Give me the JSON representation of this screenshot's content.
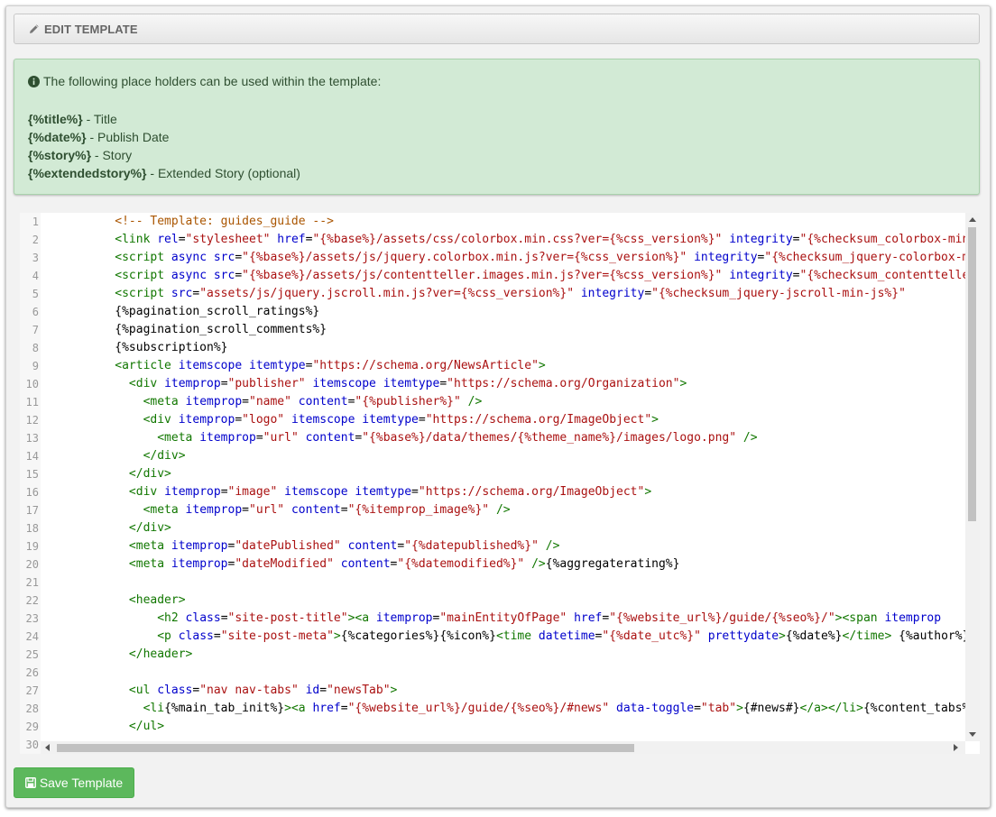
{
  "panel": {
    "heading": "EDIT TEMPLATE",
    "heading_icon": "pencil-icon"
  },
  "info": {
    "icon": "info-circle-icon",
    "intro": "The following place holders can be used within the template:",
    "placeholders": [
      {
        "token": "{%title%}",
        "desc": " - Title"
      },
      {
        "token": "{%date%}",
        "desc": " - Publish Date"
      },
      {
        "token": "{%story%}",
        "desc": " - Story"
      },
      {
        "token": "{%extendedstory%}",
        "desc": " - Extended Story (optional)"
      }
    ]
  },
  "editor": {
    "line_numbers": [
      "1",
      "2",
      "3",
      "4",
      "5",
      "6",
      "7",
      "8",
      "9",
      "10",
      "11",
      "12",
      "13",
      "14",
      "15",
      "16",
      "17",
      "18",
      "19",
      "20",
      "21",
      "22",
      "23",
      "24",
      "25",
      "26",
      "27",
      "28",
      "29",
      "30"
    ],
    "lines": [
      [
        [
          "cm",
          "          <!-- Template: guides_guide -->"
        ]
      ],
      [
        [
          "tg",
          "          <link "
        ],
        [
          "at",
          "rel"
        ],
        [
          "tx",
          "="
        ],
        [
          "st",
          "\"stylesheet\""
        ],
        [
          "tx",
          " "
        ],
        [
          "at",
          "href"
        ],
        [
          "tx",
          "="
        ],
        [
          "st",
          "\"{%base%}/assets/css/colorbox.min.css?ver={%css_version%}\""
        ],
        [
          "tx",
          " "
        ],
        [
          "at",
          "integrity"
        ],
        [
          "tx",
          "="
        ],
        [
          "st",
          "\"{%checksum_colorbox-min-css%}\""
        ]
      ],
      [
        [
          "tg",
          "          <script "
        ],
        [
          "at",
          "async"
        ],
        [
          "tx",
          " "
        ],
        [
          "at",
          "src"
        ],
        [
          "tx",
          "="
        ],
        [
          "st",
          "\"{%base%}/assets/js/jquery.colorbox.min.js?ver={%css_version%}\""
        ],
        [
          "tx",
          " "
        ],
        [
          "at",
          "integrity"
        ],
        [
          "tx",
          "="
        ],
        [
          "st",
          "\"{%checksum_jquery-colorbox-min-js%}\""
        ]
      ],
      [
        [
          "tg",
          "          <script "
        ],
        [
          "at",
          "async"
        ],
        [
          "tx",
          " "
        ],
        [
          "at",
          "src"
        ],
        [
          "tx",
          "="
        ],
        [
          "st",
          "\"{%base%}/assets/js/contentteller.images.min.js?ver={%css_version%}\""
        ],
        [
          "tx",
          " "
        ],
        [
          "at",
          "integrity"
        ],
        [
          "tx",
          "="
        ],
        [
          "st",
          "\"{%checksum_contentteller-images-min-js%}\""
        ]
      ],
      [
        [
          "tg",
          "          <script "
        ],
        [
          "at",
          "src"
        ],
        [
          "tx",
          "="
        ],
        [
          "st",
          "\"assets/js/jquery.jscroll.min.js?ver={%css_version%}\""
        ],
        [
          "tx",
          " "
        ],
        [
          "at",
          "integrity"
        ],
        [
          "tx",
          "="
        ],
        [
          "st",
          "\"{%checksum_jquery-jscroll-min-js%}\""
        ]
      ],
      [
        [
          "tx",
          "          {%pagination_scroll_ratings%}"
        ]
      ],
      [
        [
          "tx",
          "          {%pagination_scroll_comments%}"
        ]
      ],
      [
        [
          "tx",
          "          {%subscription%}"
        ]
      ],
      [
        [
          "tg",
          "          <article "
        ],
        [
          "at",
          "itemscope"
        ],
        [
          "tx",
          " "
        ],
        [
          "at",
          "itemtype"
        ],
        [
          "tx",
          "="
        ],
        [
          "st",
          "\"https://schema.org/NewsArticle\""
        ],
        [
          "tg",
          ">"
        ]
      ],
      [
        [
          "tg",
          "            <div "
        ],
        [
          "at",
          "itemprop"
        ],
        [
          "tx",
          "="
        ],
        [
          "st",
          "\"publisher\""
        ],
        [
          "tx",
          " "
        ],
        [
          "at",
          "itemscope"
        ],
        [
          "tx",
          " "
        ],
        [
          "at",
          "itemtype"
        ],
        [
          "tx",
          "="
        ],
        [
          "st",
          "\"https://schema.org/Organization\""
        ],
        [
          "tg",
          ">"
        ]
      ],
      [
        [
          "tg",
          "              <meta "
        ],
        [
          "at",
          "itemprop"
        ],
        [
          "tx",
          "="
        ],
        [
          "st",
          "\"name\""
        ],
        [
          "tx",
          " "
        ],
        [
          "at",
          "content"
        ],
        [
          "tx",
          "="
        ],
        [
          "st",
          "\"{%publisher%}\""
        ],
        [
          "tx",
          " "
        ],
        [
          "tg",
          "/>"
        ]
      ],
      [
        [
          "tg",
          "              <div "
        ],
        [
          "at",
          "itemprop"
        ],
        [
          "tx",
          "="
        ],
        [
          "st",
          "\"logo\""
        ],
        [
          "tx",
          " "
        ],
        [
          "at",
          "itemscope"
        ],
        [
          "tx",
          " "
        ],
        [
          "at",
          "itemtype"
        ],
        [
          "tx",
          "="
        ],
        [
          "st",
          "\"https://schema.org/ImageObject\""
        ],
        [
          "tg",
          ">"
        ]
      ],
      [
        [
          "tg",
          "                <meta "
        ],
        [
          "at",
          "itemprop"
        ],
        [
          "tx",
          "="
        ],
        [
          "st",
          "\"url\""
        ],
        [
          "tx",
          " "
        ],
        [
          "at",
          "content"
        ],
        [
          "tx",
          "="
        ],
        [
          "st",
          "\"{%base%}/data/themes/{%theme_name%}/images/logo.png\""
        ],
        [
          "tx",
          " "
        ],
        [
          "tg",
          "/>"
        ]
      ],
      [
        [
          "tg",
          "              </div>"
        ]
      ],
      [
        [
          "tg",
          "            </div>"
        ]
      ],
      [
        [
          "tg",
          "            <div "
        ],
        [
          "at",
          "itemprop"
        ],
        [
          "tx",
          "="
        ],
        [
          "st",
          "\"image\""
        ],
        [
          "tx",
          " "
        ],
        [
          "at",
          "itemscope"
        ],
        [
          "tx",
          " "
        ],
        [
          "at",
          "itemtype"
        ],
        [
          "tx",
          "="
        ],
        [
          "st",
          "\"https://schema.org/ImageObject\""
        ],
        [
          "tg",
          ">"
        ]
      ],
      [
        [
          "tg",
          "              <meta "
        ],
        [
          "at",
          "itemprop"
        ],
        [
          "tx",
          "="
        ],
        [
          "st",
          "\"url\""
        ],
        [
          "tx",
          " "
        ],
        [
          "at",
          "content"
        ],
        [
          "tx",
          "="
        ],
        [
          "st",
          "\"{%itemprop_image%}\""
        ],
        [
          "tx",
          " "
        ],
        [
          "tg",
          "/>"
        ]
      ],
      [
        [
          "tg",
          "            </div>"
        ]
      ],
      [
        [
          "tg",
          "            <meta "
        ],
        [
          "at",
          "itemprop"
        ],
        [
          "tx",
          "="
        ],
        [
          "st",
          "\"datePublished\""
        ],
        [
          "tx",
          " "
        ],
        [
          "at",
          "content"
        ],
        [
          "tx",
          "="
        ],
        [
          "st",
          "\"{%datepublished%}\""
        ],
        [
          "tx",
          " "
        ],
        [
          "tg",
          "/>"
        ]
      ],
      [
        [
          "tg",
          "            <meta "
        ],
        [
          "at",
          "itemprop"
        ],
        [
          "tx",
          "="
        ],
        [
          "st",
          "\"dateModified\""
        ],
        [
          "tx",
          " "
        ],
        [
          "at",
          "content"
        ],
        [
          "tx",
          "="
        ],
        [
          "st",
          "\"{%datemodified%}\""
        ],
        [
          "tx",
          " "
        ],
        [
          "tg",
          "/>"
        ],
        [
          "tx",
          "{%aggregaterating%}"
        ]
      ],
      [],
      [
        [
          "tg",
          "            <header>"
        ]
      ],
      [
        [
          "tg",
          "                <h2 "
        ],
        [
          "at",
          "class"
        ],
        [
          "tx",
          "="
        ],
        [
          "st",
          "\"site-post-title\""
        ],
        [
          "tg",
          "><a "
        ],
        [
          "at",
          "itemprop"
        ],
        [
          "tx",
          "="
        ],
        [
          "st",
          "\"mainEntityOfPage\""
        ],
        [
          "tx",
          " "
        ],
        [
          "at",
          "href"
        ],
        [
          "tx",
          "="
        ],
        [
          "st",
          "\"{%website_url%}/guide/{%seo%}/\""
        ],
        [
          "tg",
          "><span "
        ],
        [
          "at",
          "itemprop"
        ]
      ],
      [
        [
          "tg",
          "                <p "
        ],
        [
          "at",
          "class"
        ],
        [
          "tx",
          "="
        ],
        [
          "st",
          "\"site-post-meta\""
        ],
        [
          "tg",
          ">"
        ],
        [
          "tx",
          "{%categories%}{%icon%}"
        ],
        [
          "tg",
          "<time "
        ],
        [
          "at",
          "datetime"
        ],
        [
          "tx",
          "="
        ],
        [
          "st",
          "\"{%date_utc%}\""
        ],
        [
          "tx",
          " "
        ],
        [
          "at",
          "prettydate"
        ],
        [
          "tg",
          ">"
        ],
        [
          "tx",
          "{%date%}"
        ],
        [
          "tg",
          "</time>"
        ],
        [
          "tx",
          " {%author%}"
        ]
      ],
      [
        [
          "tg",
          "            </header>"
        ]
      ],
      [],
      [
        [
          "tg",
          "            <ul "
        ],
        [
          "at",
          "class"
        ],
        [
          "tx",
          "="
        ],
        [
          "st",
          "\"nav nav-tabs\""
        ],
        [
          "tx",
          " "
        ],
        [
          "at",
          "id"
        ],
        [
          "tx",
          "="
        ],
        [
          "st",
          "\"newsTab\""
        ],
        [
          "tg",
          ">"
        ]
      ],
      [
        [
          "tg",
          "              <li"
        ],
        [
          "tx",
          "{%main_tab_init%}"
        ],
        [
          "tg",
          "><a "
        ],
        [
          "at",
          "href"
        ],
        [
          "tx",
          "="
        ],
        [
          "st",
          "\"{%website_url%}/guide/{%seo%}/#news\""
        ],
        [
          "tx",
          " "
        ],
        [
          "at",
          "data-toggle"
        ],
        [
          "tx",
          "="
        ],
        [
          "st",
          "\"tab\""
        ],
        [
          "tg",
          ">"
        ],
        [
          "tx",
          "{#news#}"
        ],
        [
          "tg",
          "</a></li>"
        ],
        [
          "tx",
          "{%content_tabs%}"
        ]
      ],
      [
        [
          "tg",
          "            </ul>"
        ]
      ],
      []
    ]
  },
  "save": {
    "label": "Save Template",
    "icon": "floppy-disk-icon"
  },
  "colors": {
    "info_bg": "#d2ead5",
    "save_bg": "#5cb85c",
    "tag": "#117700",
    "attribute": "#0000cc",
    "string": "#aa1111",
    "comment": "#aa5500"
  }
}
